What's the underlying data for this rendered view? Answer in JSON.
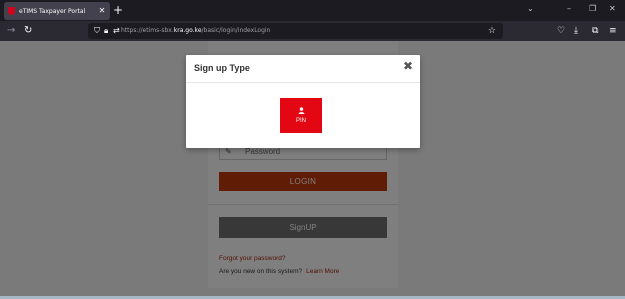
{
  "browser": {
    "tab": {
      "title": "eTIMS Taxpayer Portal"
    },
    "url": {
      "prefix": "https://etims-sbx.",
      "domain": "kra.go.ke",
      "path": "/basic/login/indexLogin"
    }
  },
  "login": {
    "password_placeholder": "Password",
    "login_label": "LOGIN",
    "signup_label": "SignUP",
    "forgot_label": "Forgot your password?",
    "new_text": "Are you new on this system?",
    "learn_more_label": "Learn More"
  },
  "modal": {
    "title": "Sign up Type",
    "close_glyph": "✖",
    "pin_label": "PIN"
  },
  "colors": {
    "pin_button": "#e30613",
    "login_button": "#c0390b",
    "signup_button": "#707070",
    "link": "#a3280a"
  },
  "icons": [
    "tab-favicon",
    "close-icon",
    "plus-icon",
    "chevron-down-icon",
    "minimize-icon",
    "restore-icon",
    "back-icon",
    "reload-icon",
    "shield-icon",
    "lock-icon",
    "permissions-icon",
    "star-icon",
    "pocket-icon",
    "download-icon",
    "extensions-icon",
    "menu-icon",
    "pencil-icon",
    "user-icon"
  ]
}
